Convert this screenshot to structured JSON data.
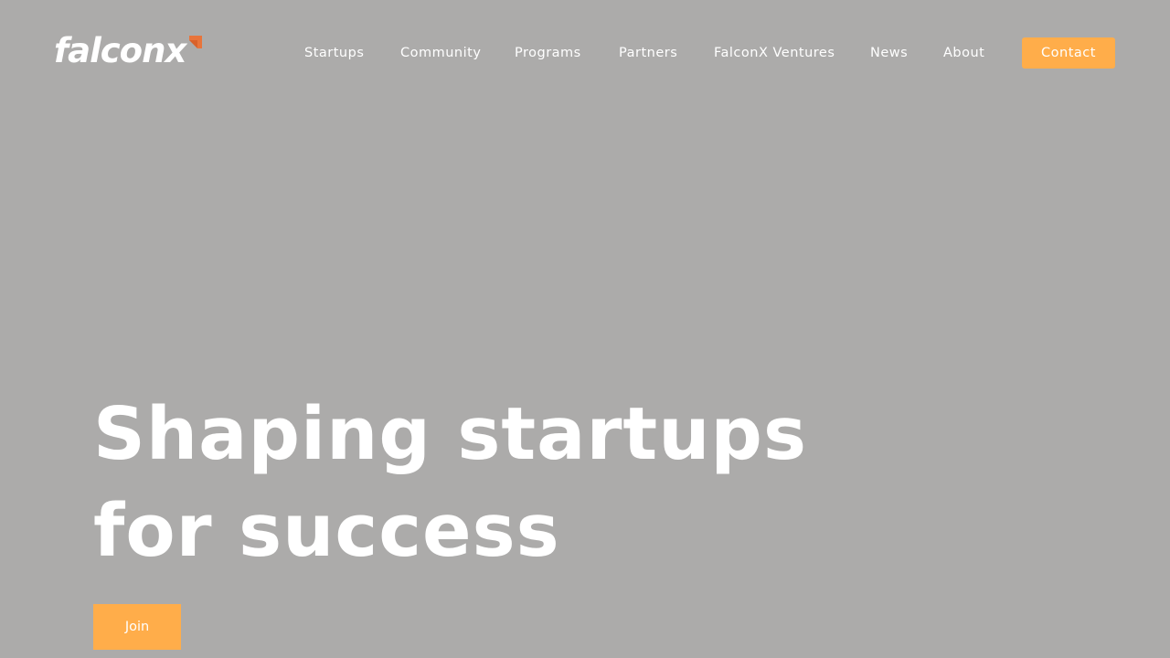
{
  "brand": {
    "logo_text": "falconx",
    "accent_color": "#e8743b",
    "button_color": "#ffad4a",
    "background_color": "#acabaa"
  },
  "nav": {
    "items": [
      {
        "label": "Startups"
      },
      {
        "label": "Community"
      },
      {
        "label": "Programs"
      },
      {
        "label": "Partners"
      },
      {
        "label": "FalconX Ventures"
      },
      {
        "label": "News"
      },
      {
        "label": "About"
      }
    ],
    "contact_label": "Contact"
  },
  "hero": {
    "title_line1": "Shaping startups",
    "title_line2": "for success",
    "join_label": "Join"
  }
}
